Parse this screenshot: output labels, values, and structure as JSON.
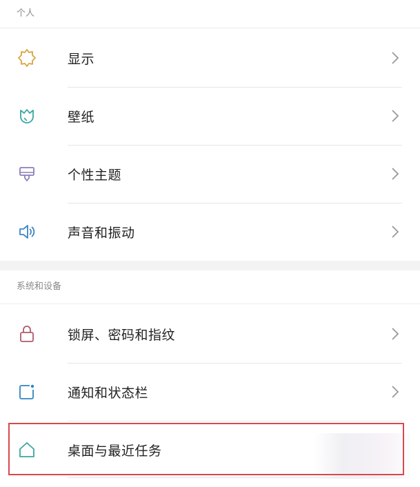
{
  "sections": [
    {
      "title": "个人",
      "items": [
        {
          "label": "显示",
          "icon": "sun-icon"
        },
        {
          "label": "壁纸",
          "icon": "tulip-icon"
        },
        {
          "label": "个性主题",
          "icon": "brush-icon"
        },
        {
          "label": "声音和振动",
          "icon": "speaker-icon"
        }
      ]
    },
    {
      "title": "系统和设备",
      "items": [
        {
          "label": "锁屏、密码和指纹",
          "icon": "lock-icon"
        },
        {
          "label": "通知和状态栏",
          "icon": "notification-icon"
        },
        {
          "label": "桌面与最近任务",
          "icon": "home-icon"
        }
      ]
    }
  ],
  "colors": {
    "sun": "#d9a441",
    "tulip": "#3aa6a0",
    "brush": "#8b7fb8",
    "speaker": "#3b86c4",
    "lock": "#b05a6a",
    "notification": "#2f84c2",
    "home": "#3aa6a0",
    "highlight_border": "#d9474c"
  }
}
